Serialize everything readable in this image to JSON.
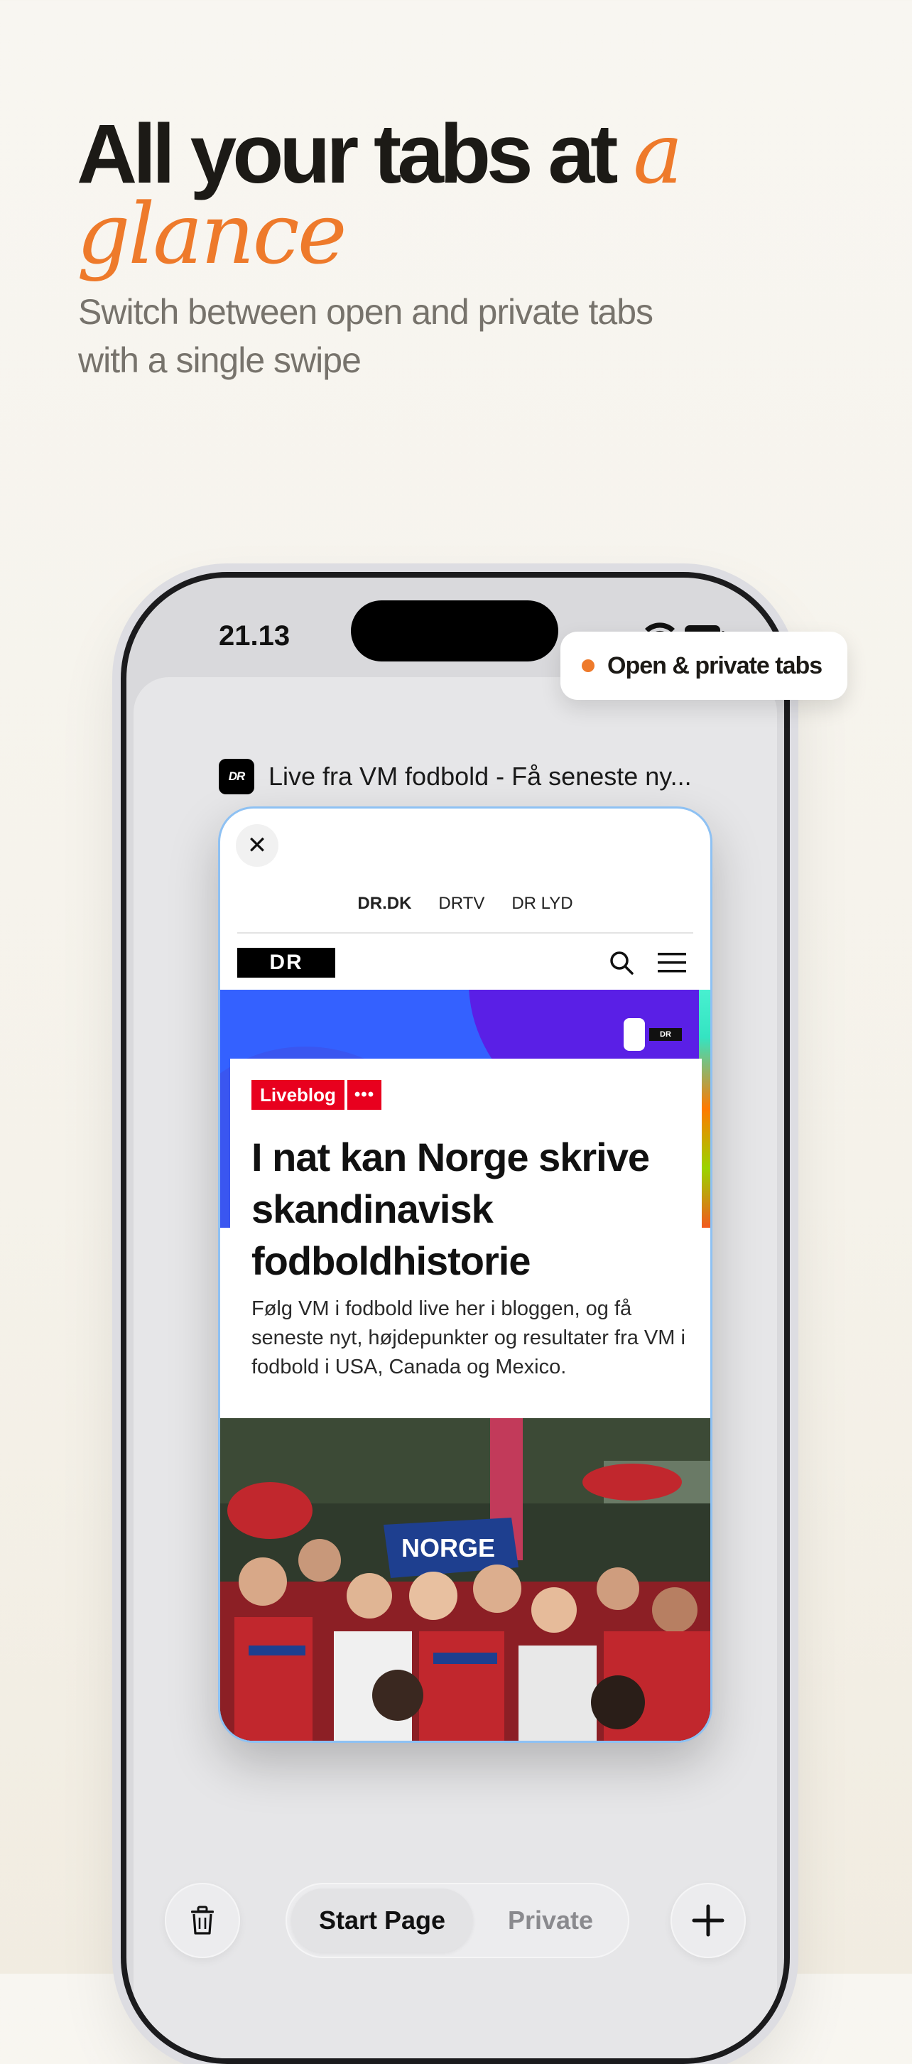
{
  "headline": {
    "title_main": "All your tabs at ",
    "title_accent_1": "a",
    "title_accent_2": "glance",
    "subtitle_line1": "Switch between open and private tabs",
    "subtitle_line2": "with a single swipe"
  },
  "status_bar": {
    "time": "21.13"
  },
  "feature_pill": {
    "label": "Open & private tabs",
    "dot_color": "#ee7a2b"
  },
  "tab": {
    "favicon_text": "DR",
    "title": "Live fra VM fodbold - Få seneste ny...",
    "close_symbol": "✕"
  },
  "page": {
    "nav": [
      "DR.DK",
      "DRTV",
      "DR LYD"
    ],
    "logo": "DR",
    "badge_label": "Liveblog",
    "badge_more": "•••",
    "headline": "I nat kan Norge skrive skandinavisk fodboldhistorie",
    "lead": "Følg VM i fodbold live her i bloggen, og få seneste nyt, højdepunkter og resultater fra VM i fodbold i USA, Canada og Mexico.",
    "photo_banner": "NORGE"
  },
  "toolbar": {
    "segment_selected": "Start Page",
    "segment_other": "Private",
    "trash_icon": "trash-icon",
    "plus_icon": "plus-icon"
  },
  "colors": {
    "accent": "#ee7a2b",
    "dr_red": "#e8001e",
    "card_border": "#8ec1f3"
  }
}
